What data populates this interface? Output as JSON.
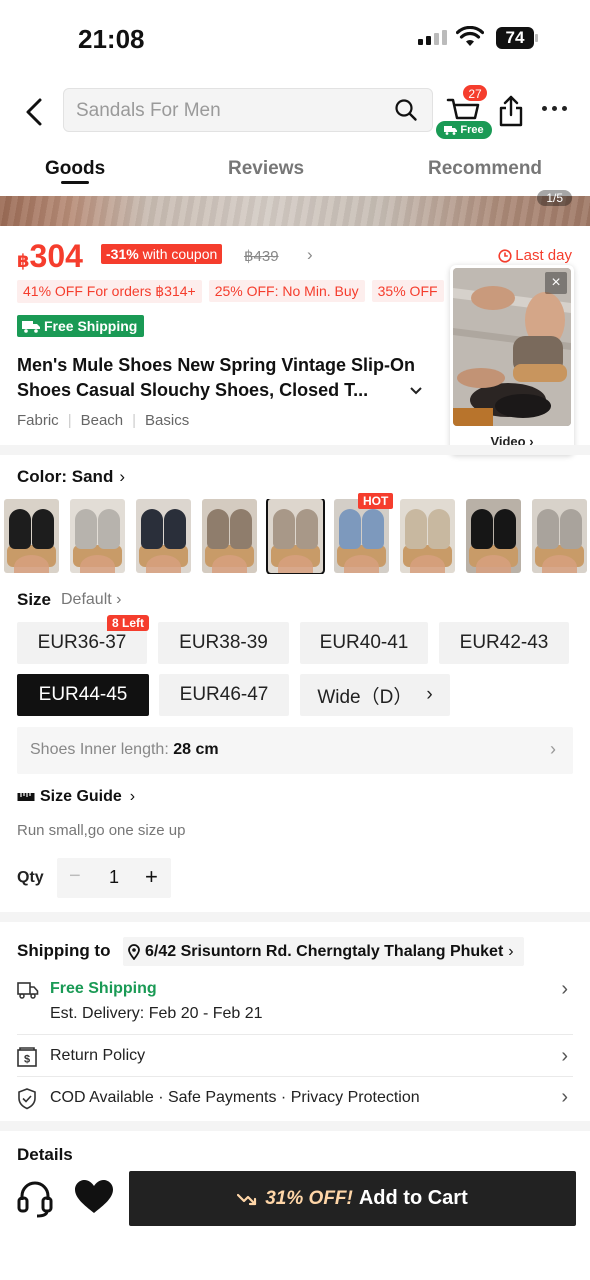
{
  "status_bar": {
    "time": "21:08",
    "battery": "74"
  },
  "header": {
    "search_placeholder": "Sandals For Men",
    "cart_count": "27",
    "free_tag": "Free"
  },
  "tabs": [
    {
      "label": "Goods",
      "active": true
    },
    {
      "label": "Reviews",
      "active": false
    },
    {
      "label": "Recommend",
      "active": false
    }
  ],
  "image_counter": "1/5",
  "price": {
    "currency": "฿",
    "amount": "304",
    "coupon_pct": "-31%",
    "coupon_text": "with coupon",
    "original": "฿439",
    "last_day": "Last day"
  },
  "promos": [
    "41% OFF For orders ฿314+",
    "25% OFF: No Min. Buy",
    "35% OFF"
  ],
  "shipping_tag": "Free Shipping",
  "product": {
    "title": "Men's Mule Shoes New Spring Vintage Slip-On Shoes Casual Slouchy Shoes, Closed T...",
    "attributes": [
      "Fabric",
      "Beach",
      "Basics"
    ]
  },
  "video": {
    "label": "Video ›"
  },
  "color": {
    "label": "Color: Sand",
    "hot_badge": "HOT",
    "swatches": [
      {
        "name": "black",
        "shoe": "#1d1d1d",
        "bg": "#d9d2c8"
      },
      {
        "name": "grey",
        "shoe": "#b7b3ad",
        "bg": "#e2ddd6"
      },
      {
        "name": "navy-pattern",
        "shoe": "#2a2f3a",
        "bg": "#dcd6cf"
      },
      {
        "name": "taupe",
        "shoe": "#8f7d6c",
        "bg": "#d4cbc0"
      },
      {
        "name": "sand",
        "shoe": "#a89888",
        "bg": "#ddd6cd"
      },
      {
        "name": "blue-pattern",
        "shoe": "#7d99bd",
        "bg": "#d3cec7"
      },
      {
        "name": "beige",
        "shoe": "#c8b8a0",
        "bg": "#e1dbd2"
      },
      {
        "name": "black-dark",
        "shoe": "#161616",
        "bg": "#b9b1a7"
      },
      {
        "name": "light-grey",
        "shoe": "#a9a39c",
        "bg": "#d8d2ca"
      }
    ]
  },
  "size": {
    "label": "Size",
    "default_label": "Default",
    "left_badge": "8 Left",
    "options": [
      "EUR36-37",
      "EUR38-39",
      "EUR40-41",
      "EUR42-43",
      "EUR44-45",
      "EUR46-47",
      "Wide（D）"
    ],
    "selected": "EUR44-45",
    "inner_length_label": "Shoes Inner length:",
    "inner_length_value": "28 cm",
    "guide": "Size Guide",
    "fit_note": "Run small,go one size up"
  },
  "qty": {
    "label": "Qty",
    "value": "1"
  },
  "shipping": {
    "label": "Shipping to",
    "address": "6/42 Srisuntorn Rd. Cherngtaly Thalang Phuket",
    "free_label": "Free Shipping",
    "est": "Est. Delivery: Feb 20 - Feb 21",
    "return_policy": "Return Policy",
    "cod": "COD Available · Safe Payments · Privacy Protection"
  },
  "details_label": "Details",
  "bottom": {
    "discount": "31% OFF!",
    "add_to_cart": "Add to Cart"
  },
  "colors": {
    "accent": "#f53d2d",
    "green": "#1a9a55",
    "dark": "#222222"
  }
}
